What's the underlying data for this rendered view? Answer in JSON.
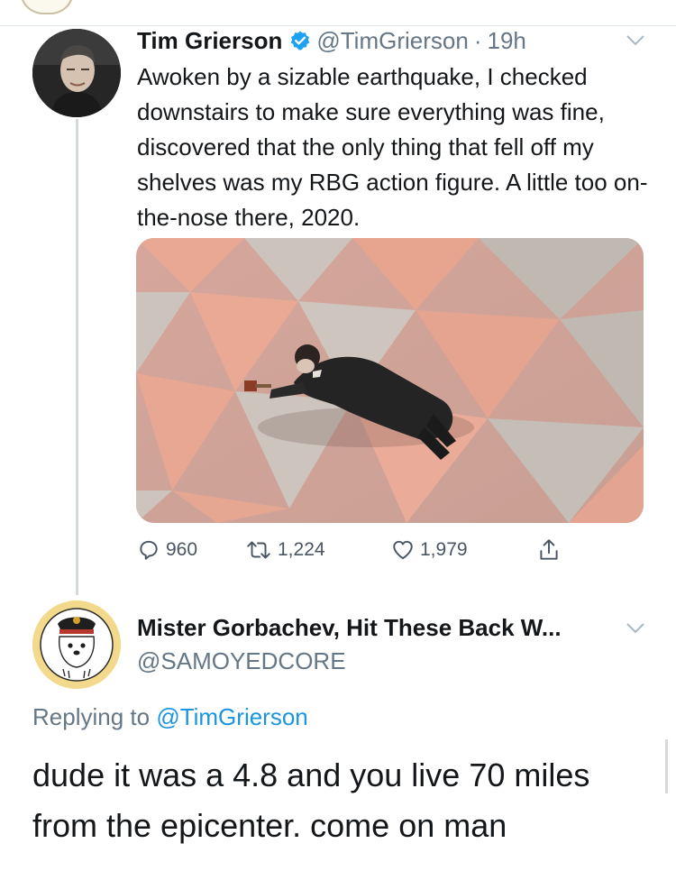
{
  "tweet": {
    "author_name": "Tim Grierson",
    "author_handle": "@TimGrierson",
    "separator": "·",
    "time": "19h",
    "text": "Awoken by a sizable earthquake, I checked downstairs to make sure everything was fine, discovered that the only thing that fell off my shelves was my RBG action figure. A little too on-the-nose there, 2020.",
    "stats": {
      "replies": "960",
      "retweets": "1,224",
      "likes": "1,979"
    },
    "verified_color": "#1da1f2",
    "icons": [
      "verified-badge-icon",
      "chevron-down-icon",
      "reply-icon",
      "retweet-icon",
      "like-icon",
      "share-icon"
    ]
  },
  "reply": {
    "author_name": "Mister Gorbachev, Hit These Back W...",
    "author_handle": "@SAMOYEDCORE",
    "replying_prefix": "Replying to",
    "replying_to": "@TimGrierson",
    "text": "dude it was a 4.8 and you live 70 miles from the epicenter. come on man"
  },
  "colors": {
    "text": "#14171a",
    "secondary": "#657786",
    "link": "#1b95e0",
    "thread_line": "#cfd9de"
  }
}
